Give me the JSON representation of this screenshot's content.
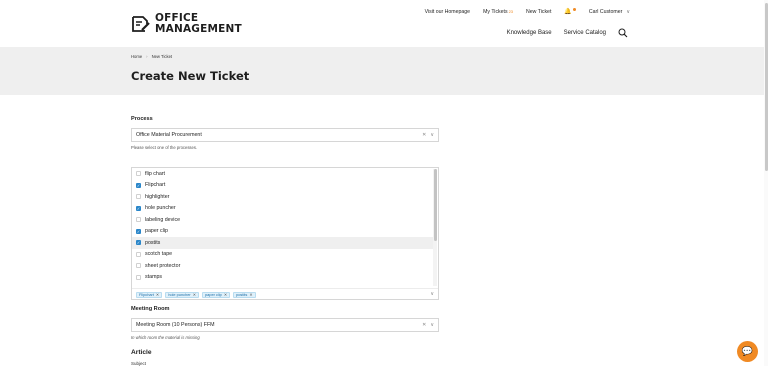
{
  "brand": {
    "line1": "OFFICE",
    "line2": "MANAGEMENT"
  },
  "topnav": {
    "homepage": "Visit our Homepage",
    "my_tickets": "My Tickets",
    "my_tickets_badge": "23",
    "new_ticket": "New Ticket",
    "user": "Carl Customer"
  },
  "mainnav": {
    "knowledge_base": "Knowledge Base",
    "service_catalog": "Service Catalog"
  },
  "breadcrumb": {
    "home": "Home",
    "current": "New Ticket"
  },
  "page_title": "Create New Ticket",
  "process": {
    "label": "Process",
    "value": "Office Material Procurement",
    "help": "Please select one of the processes."
  },
  "materials": {
    "items": [
      {
        "label": "flip chart",
        "checked": false
      },
      {
        "label": "Flipchart",
        "checked": true
      },
      {
        "label": "highlighter",
        "checked": false
      },
      {
        "label": "hole puncher",
        "checked": true
      },
      {
        "label": "labeling device",
        "checked": false
      },
      {
        "label": "paper clip",
        "checked": true
      },
      {
        "label": "postits",
        "checked": true
      },
      {
        "label": "scotch tape",
        "checked": false
      },
      {
        "label": "sheet protector",
        "checked": false
      },
      {
        "label": "stamps",
        "checked": false
      }
    ],
    "tags": [
      "Flipchart",
      "hole puncher",
      "paper clip",
      "postits"
    ]
  },
  "meeting_room": {
    "label": "Meeting Room",
    "value": "Meeting Room (10 Persons) FFM",
    "help": "In which room the material is missing"
  },
  "article": {
    "title": "Article",
    "subject": "Subject"
  },
  "colors": {
    "accent": "#f08a24",
    "check": "#2a86c9",
    "banner": "#efefef"
  }
}
